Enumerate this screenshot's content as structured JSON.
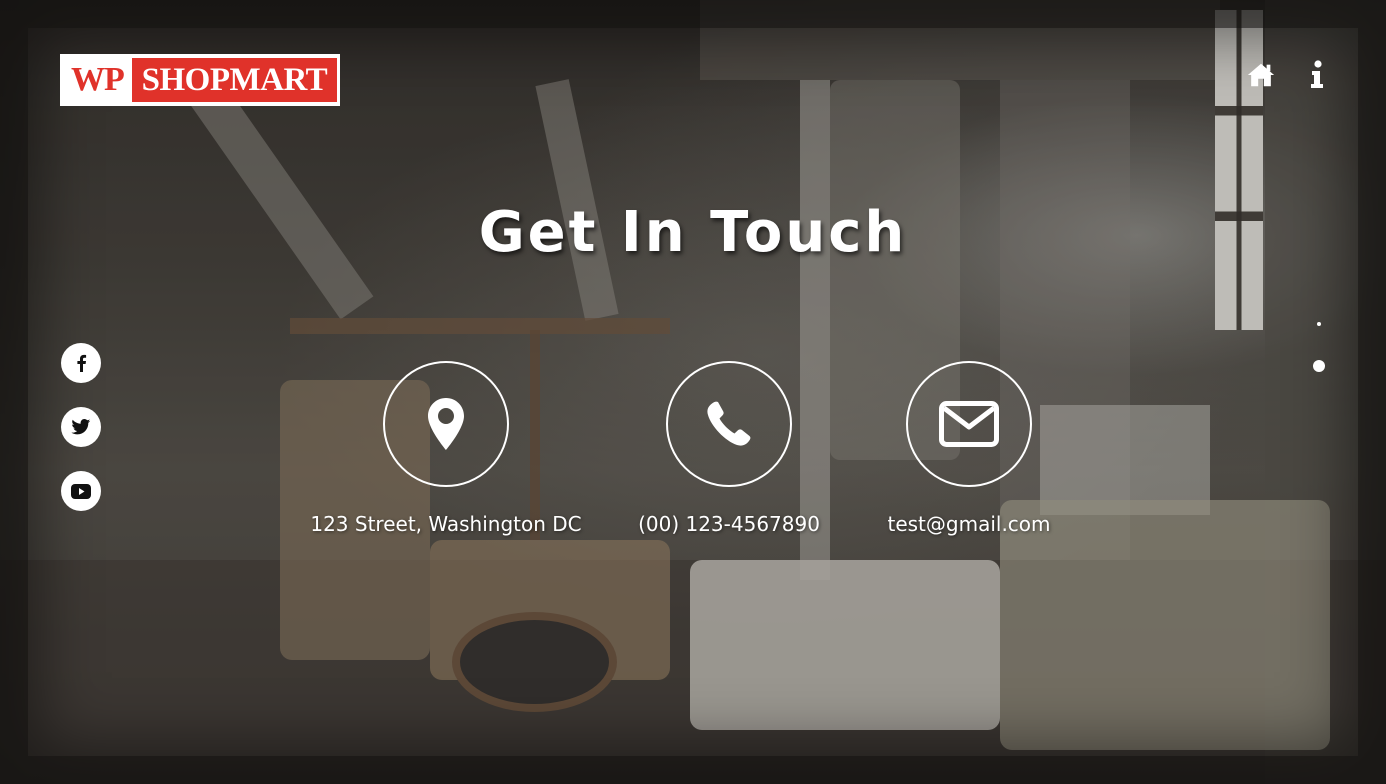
{
  "logo": {
    "part1": "WP",
    "part2": "SHOPMART"
  },
  "nav": {
    "icons": [
      "home-icon",
      "info-icon"
    ]
  },
  "hero": {
    "title": "Get In Touch"
  },
  "social": [
    "facebook-icon",
    "twitter-icon",
    "youtube-icon"
  ],
  "contact": {
    "address": "123 Street, Washington DC",
    "phone": "(00) 123-4567890",
    "email": "test@gmail.com"
  },
  "colors": {
    "brand_red": "#e0322a",
    "text": "#ffffff"
  }
}
